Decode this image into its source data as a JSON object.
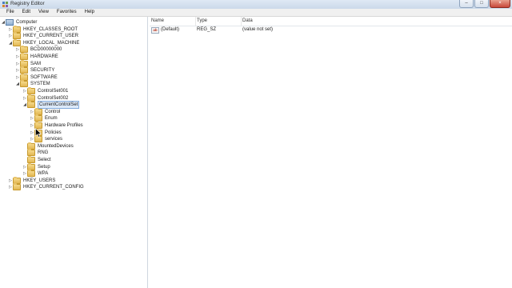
{
  "window": {
    "title": "Registry Editor"
  },
  "menu": [
    "File",
    "Edit",
    "View",
    "Favorites",
    "Help"
  ],
  "tree": [
    {
      "label": "Computer",
      "depth": 0,
      "expander": "open",
      "icon": "computer"
    },
    {
      "label": "HKEY_CLASSES_ROOT",
      "depth": 1,
      "expander": "closed",
      "icon": "folder"
    },
    {
      "label": "HKEY_CURRENT_USER",
      "depth": 1,
      "expander": "closed",
      "icon": "folder"
    },
    {
      "label": "HKEY_LOCAL_MACHINE",
      "depth": 1,
      "expander": "open",
      "icon": "folder"
    },
    {
      "label": "BCD00000000",
      "depth": 2,
      "expander": "closed",
      "icon": "folder"
    },
    {
      "label": "HARDWARE",
      "depth": 2,
      "expander": "closed",
      "icon": "folder"
    },
    {
      "label": "SAM",
      "depth": 2,
      "expander": "closed",
      "icon": "folder"
    },
    {
      "label": "SECURITY",
      "depth": 2,
      "expander": "closed",
      "icon": "folder"
    },
    {
      "label": "SOFTWARE",
      "depth": 2,
      "expander": "closed",
      "icon": "folder"
    },
    {
      "label": "SYSTEM",
      "depth": 2,
      "expander": "open",
      "icon": "folder"
    },
    {
      "label": "ControlSet001",
      "depth": 3,
      "expander": "closed",
      "icon": "folder"
    },
    {
      "label": "ControlSet002",
      "depth": 3,
      "expander": "closed",
      "icon": "folder"
    },
    {
      "label": "CurrentControlSet",
      "depth": 3,
      "expander": "open",
      "icon": "folder",
      "selected": true
    },
    {
      "label": "Control",
      "depth": 4,
      "expander": "closed",
      "icon": "folder"
    },
    {
      "label": "Enum",
      "depth": 4,
      "expander": "closed",
      "icon": "folder"
    },
    {
      "label": "Hardware Profiles",
      "depth": 4,
      "expander": "closed",
      "icon": "folder"
    },
    {
      "label": "Policies",
      "depth": 4,
      "expander": "closed",
      "icon": "folder"
    },
    {
      "label": "services",
      "depth": 4,
      "expander": "closed",
      "icon": "folder"
    },
    {
      "label": "MountedDevices",
      "depth": 3,
      "expander": "none",
      "icon": "folder"
    },
    {
      "label": "RNG",
      "depth": 3,
      "expander": "none",
      "icon": "folder"
    },
    {
      "label": "Select",
      "depth": 3,
      "expander": "none",
      "icon": "folder"
    },
    {
      "label": "Setup",
      "depth": 3,
      "expander": "closed",
      "icon": "folder"
    },
    {
      "label": "WPA",
      "depth": 3,
      "expander": "closed",
      "icon": "folder"
    },
    {
      "label": "HKEY_USERS",
      "depth": 1,
      "expander": "closed",
      "icon": "folder"
    },
    {
      "label": "HKEY_CURRENT_CONFIG",
      "depth": 1,
      "expander": "closed",
      "icon": "folder"
    }
  ],
  "list": {
    "headers": {
      "name": "Name",
      "type": "Type",
      "data": "Data"
    },
    "rows": [
      {
        "name": "(Default)",
        "type": "REG_SZ",
        "data": "(value not set)",
        "icon": "ab"
      }
    ]
  },
  "colors": {
    "selection": "#dce9f9",
    "selection_border": "#84acdd",
    "folder": "#e2b754"
  }
}
